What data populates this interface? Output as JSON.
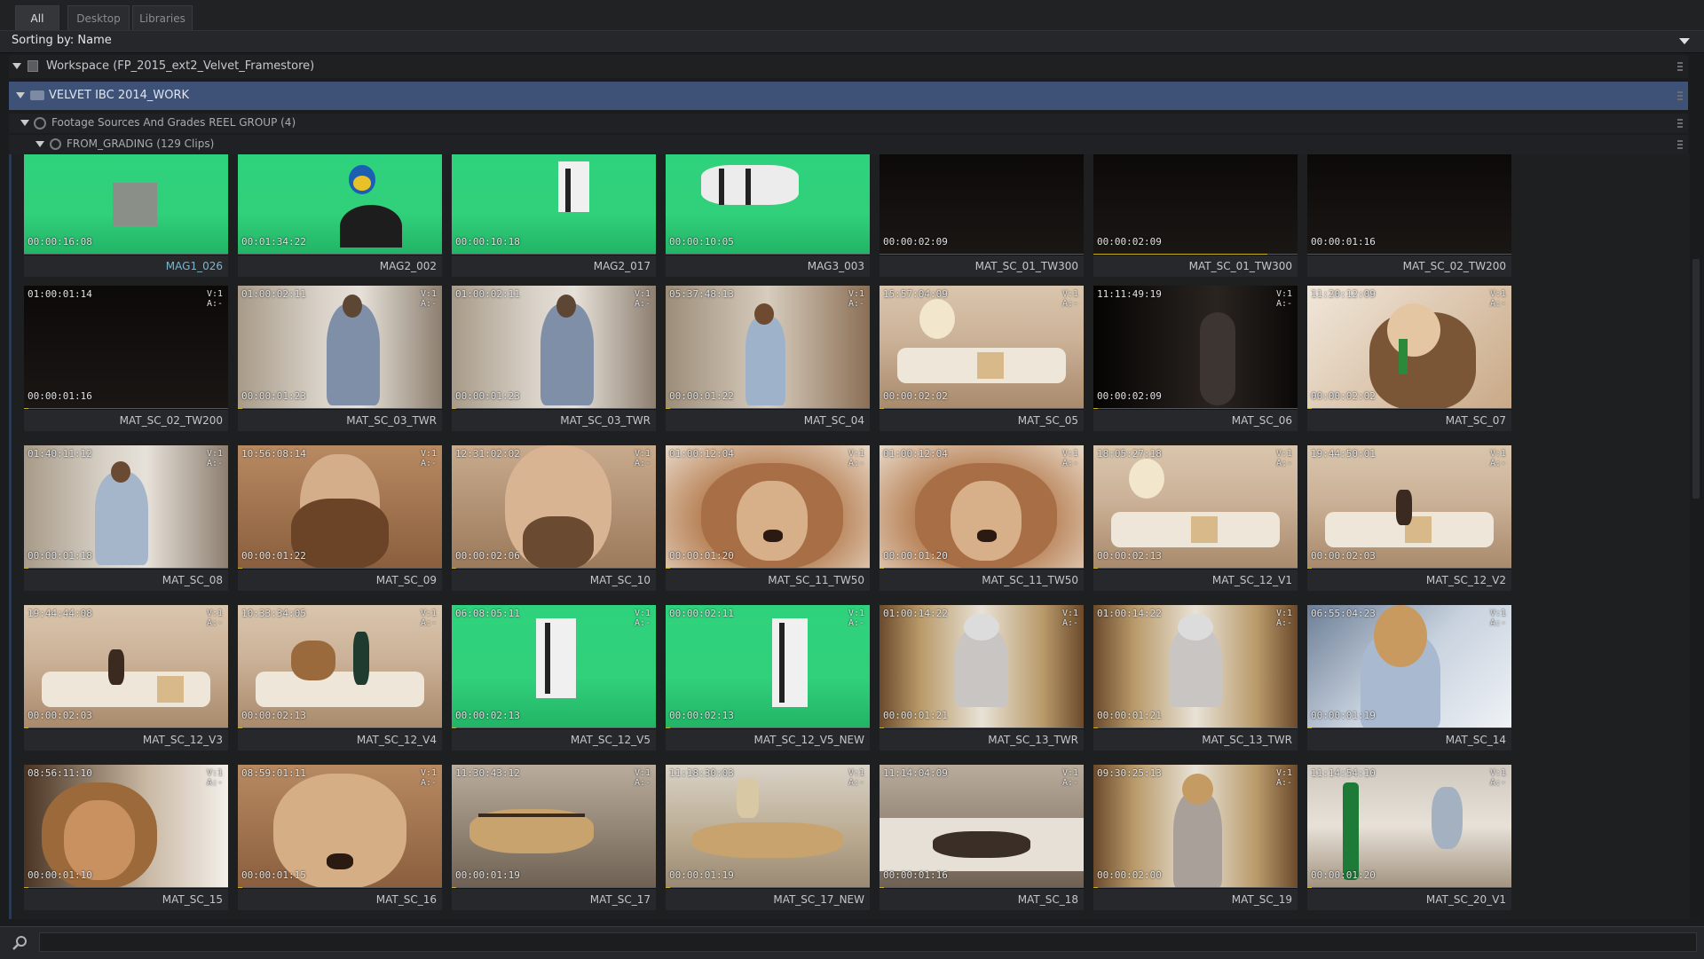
{
  "tabs": [
    {
      "label": "All",
      "active": true
    },
    {
      "label": "Desktop",
      "active": false
    },
    {
      "label": "Libraries",
      "active": false
    }
  ],
  "sorting_label": "Sorting by: Name",
  "tree": {
    "workspace": "Workspace (FP_2015_ext2_Velvet_Framestore)",
    "library": "VELVET IBC 2014_WORK",
    "reel_group": "Footage Sources And Grades REEL GROUP (4)",
    "reel": "FROM_GRADING (129 Clips)"
  },
  "colors": {
    "selection_row": "#3e5278",
    "highlight_name": "#79b6cf",
    "progress": "#c8b020"
  },
  "clips": [
    {
      "name": "MAG1_026",
      "tc_start": "",
      "tc_dur": "00:00:16:08",
      "va": false,
      "highlight": true,
      "progress": 0
    },
    {
      "name": "MAG2_002",
      "tc_start": "",
      "tc_dur": "00:01:34:22",
      "va": false,
      "highlight": false,
      "progress": 0
    },
    {
      "name": "MAG2_017",
      "tc_start": "",
      "tc_dur": "00:00:10:18",
      "va": false,
      "highlight": false,
      "progress": 0
    },
    {
      "name": "MAG3_003",
      "tc_start": "",
      "tc_dur": "00:00:10:05",
      "va": false,
      "highlight": false,
      "progress": 0
    },
    {
      "name": "MAT_SC_01_TW300",
      "tc_start": "",
      "tc_dur": "00:00:02:09",
      "va": false,
      "highlight": false,
      "progress": 0
    },
    {
      "name": "MAT_SC_01_TW300",
      "tc_start": "",
      "tc_dur": "00:00:02:09",
      "va": false,
      "highlight": false,
      "progress": 0.85
    },
    {
      "name": "MAT_SC_02_TW200",
      "tc_start": "",
      "tc_dur": "00:00:01:16",
      "va": false,
      "highlight": false,
      "progress": 0
    },
    {
      "name": "MAT_SC_02_TW200",
      "tc_start": "01:00:01:14",
      "tc_dur": "00:00:01:16",
      "va": true,
      "highlight": false,
      "progress": 0.02
    },
    {
      "name": "MAT_SC_03_TWR",
      "tc_start": "01:00:02:11",
      "tc_dur": "00:00:01:23",
      "va": true,
      "highlight": false,
      "progress": 0.02
    },
    {
      "name": "MAT_SC_03_TWR",
      "tc_start": "01:00:02:11",
      "tc_dur": "00:00:01:23",
      "va": true,
      "highlight": false,
      "progress": 0.02
    },
    {
      "name": "MAT_SC_04",
      "tc_start": "05:37:48:13",
      "tc_dur": "00:00:01:22",
      "va": true,
      "highlight": false,
      "progress": 0.02
    },
    {
      "name": "MAT_SC_05",
      "tc_start": "15:57:04:09",
      "tc_dur": "00:00:02:02",
      "va": true,
      "highlight": false,
      "progress": 0.02
    },
    {
      "name": "MAT_SC_06",
      "tc_start": "11:11:49:19",
      "tc_dur": "00:00:02:09",
      "va": true,
      "highlight": false,
      "progress": 0.02
    },
    {
      "name": "MAT_SC_07",
      "tc_start": "11:20:12:09",
      "tc_dur": "00:00:02:02",
      "va": true,
      "highlight": false,
      "progress": 0.02
    },
    {
      "name": "MAT_SC_08",
      "tc_start": "01:40:11:12",
      "tc_dur": "00:00:01:18",
      "va": true,
      "highlight": false,
      "progress": 0.02
    },
    {
      "name": "MAT_SC_09",
      "tc_start": "10:56:08:14",
      "tc_dur": "00:00:01:22",
      "va": true,
      "highlight": false,
      "progress": 0.02
    },
    {
      "name": "MAT_SC_10",
      "tc_start": "12:31:02:02",
      "tc_dur": "00:00:02:06",
      "va": true,
      "highlight": false,
      "progress": 0.02
    },
    {
      "name": "MAT_SC_11_TW50",
      "tc_start": "01:00:12:04",
      "tc_dur": "00:00:01:20",
      "va": true,
      "highlight": false,
      "progress": 0.02
    },
    {
      "name": "MAT_SC_11_TW50",
      "tc_start": "01:00:12:04",
      "tc_dur": "00:00:01:20",
      "va": true,
      "highlight": false,
      "progress": 0.02
    },
    {
      "name": "MAT_SC_12_V1",
      "tc_start": "18:05:27:18",
      "tc_dur": "00:00:02:13",
      "va": true,
      "highlight": false,
      "progress": 0.02
    },
    {
      "name": "MAT_SC_12_V2",
      "tc_start": "19:44:50:01",
      "tc_dur": "00:00:02:03",
      "va": true,
      "highlight": false,
      "progress": 0.02
    },
    {
      "name": "MAT_SC_12_V3",
      "tc_start": "19:44:44:08",
      "tc_dur": "00:00:02:03",
      "va": true,
      "highlight": false,
      "progress": 0.02
    },
    {
      "name": "MAT_SC_12_V4",
      "tc_start": "10:33:34:05",
      "tc_dur": "00:00:02:13",
      "va": true,
      "highlight": false,
      "progress": 0.02
    },
    {
      "name": "MAT_SC_12_V5",
      "tc_start": "06:08:05:11",
      "tc_dur": "00:00:02:13",
      "va": true,
      "highlight": false,
      "progress": 0.02
    },
    {
      "name": "MAT_SC_12_V5_NEW",
      "tc_start": "00:00:02:11",
      "tc_dur": "00:00:02:13",
      "va": true,
      "highlight": false,
      "progress": 0.02
    },
    {
      "name": "MAT_SC_13_TWR",
      "tc_start": "01:00:14:22",
      "tc_dur": "00:00:01:21",
      "va": true,
      "highlight": false,
      "progress": 0.02
    },
    {
      "name": "MAT_SC_13_TWR",
      "tc_start": "01:00:14:22",
      "tc_dur": "00:00:01:21",
      "va": true,
      "highlight": false,
      "progress": 0.02
    },
    {
      "name": "MAT_SC_14",
      "tc_start": "06:55:04:23",
      "tc_dur": "00:00:01:19",
      "va": true,
      "highlight": false,
      "progress": 0.02
    },
    {
      "name": "MAT_SC_15",
      "tc_start": "08:56:11:10",
      "tc_dur": "00:00:01:10",
      "va": true,
      "highlight": false,
      "progress": 0.02
    },
    {
      "name": "MAT_SC_16",
      "tc_start": "08:59:01:11",
      "tc_dur": "00:00:01:15",
      "va": true,
      "highlight": false,
      "progress": 0.02
    },
    {
      "name": "MAT_SC_17",
      "tc_start": "11:30:43:12",
      "tc_dur": "00:00:01:19",
      "va": true,
      "highlight": false,
      "progress": 0.02
    },
    {
      "name": "MAT_SC_17_NEW",
      "tc_start": "11:18:30:03",
      "tc_dur": "00:00:01:19",
      "va": true,
      "highlight": false,
      "progress": 0.02
    },
    {
      "name": "MAT_SC_18",
      "tc_start": "11:14:04:09",
      "tc_dur": "00:00:01:16",
      "va": true,
      "highlight": false,
      "progress": 0.02
    },
    {
      "name": "MAT_SC_19",
      "tc_start": "09:30:25:13",
      "tc_dur": "00:00:02:00",
      "va": true,
      "highlight": false,
      "progress": 0.02
    },
    {
      "name": "MAT_SC_20_V1",
      "tc_start": "11:14:54:10",
      "tc_dur": "00:00:01:20",
      "va": true,
      "highlight": false,
      "progress": 0.02
    }
  ],
  "va_text": "V:1\nA:-",
  "search": {
    "value": "",
    "placeholder": ""
  }
}
